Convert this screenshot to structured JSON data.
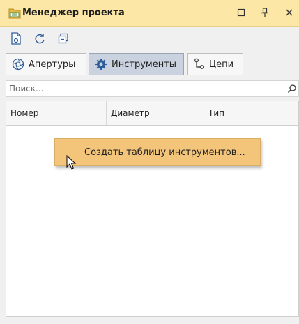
{
  "window": {
    "title": "Менеджер проекта",
    "icons": {
      "app": "folder-icon",
      "maximize": "maximize-icon",
      "pin": "pin-icon",
      "close": "close-icon"
    }
  },
  "toolbar": {
    "icons": [
      "document-icon",
      "refresh-icon",
      "collapse-icon"
    ]
  },
  "tabs": [
    {
      "label": "Апертуры",
      "icon": "aperture-icon",
      "active": false
    },
    {
      "label": "Инструменты",
      "icon": "gear-icon",
      "active": true
    },
    {
      "label": "Цепи",
      "icon": "chain-icon",
      "active": false
    }
  ],
  "search": {
    "placeholder": "Поиск...",
    "value": ""
  },
  "table": {
    "columns": [
      "Номер",
      "Диаметр",
      "Тип"
    ],
    "rows": []
  },
  "context_menu": {
    "items": [
      "Создать таблицу инструментов..."
    ]
  },
  "colors": {
    "title_bar": "#fde7a6",
    "menu_highlight": "#f3c57a",
    "active_tab": "#c9d2de"
  }
}
